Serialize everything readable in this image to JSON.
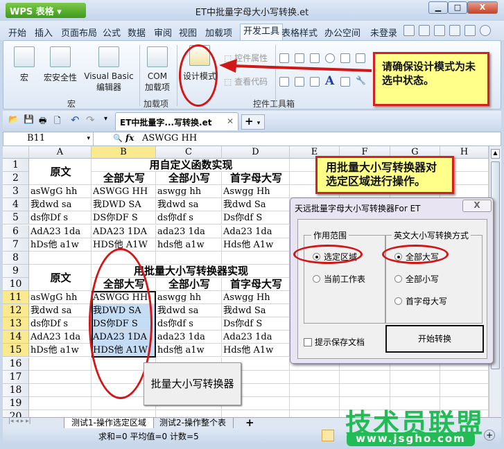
{
  "app": {
    "name": "WPS 表格",
    "title": "ET中批量字母大小写转换.et"
  },
  "menu": [
    "开始",
    "插入",
    "页面布局",
    "公式",
    "数据",
    "审阅",
    "视图",
    "加载项",
    "开发工具",
    "表格样式",
    "办公空间"
  ],
  "menu_active": "开发工具",
  "login": "未登录",
  "ribbon": {
    "macro": "宏",
    "macro_security": "宏安全性",
    "vb_editor_1": "Visual Basic",
    "vb_editor_2": "编辑器",
    "group_macro": "宏",
    "com_1": "COM",
    "com_2": "加载项",
    "group_addin": "加载项",
    "design_mode": "设计模式",
    "control_props": "控件属性",
    "view_code": "查看代码",
    "group_controls": "控件工具箱"
  },
  "callout_top": "请确保设计模式为未选中状态。",
  "callout_mid": "用批量大小写转换器对选定区域进行操作。",
  "doc_tab": "ET中批量字...写转换.et",
  "formula": {
    "cell_ref": "B11",
    "fx": "fx",
    "value": "ASWGG HH"
  },
  "columns": [
    "A",
    "B",
    "C",
    "D",
    "E",
    "F",
    "G",
    "H"
  ],
  "rows": [
    "1",
    "2",
    "3",
    "4",
    "5",
    "6",
    "7",
    "8",
    "9",
    "10",
    "11",
    "12",
    "13",
    "14",
    "15",
    "16",
    "17",
    "18",
    "19",
    "20"
  ],
  "table1": {
    "orig": "原文",
    "title": "用自定义函数实现",
    "heads": [
      "全部大写",
      "全部小写",
      "首字母大写"
    ],
    "data": [
      [
        "asWgG hh",
        "ASWGG HH",
        "aswgg hh",
        "Aswgg Hh"
      ],
      [
        "我dwd sa",
        "我DWD SA",
        "我dwd sa",
        "我dwd Sa"
      ],
      [
        "ds你Df s",
        "DS你DF S",
        "ds你df s",
        "Ds你df S"
      ],
      [
        "AdA23 1da",
        "ADA23 1DA",
        "ada23 1da",
        "Ada23 1da"
      ],
      [
        "hDs他 a1w",
        "HDS他 A1W",
        "hds他 a1w",
        "Hds他 A1w"
      ]
    ]
  },
  "table2": {
    "orig": "原文",
    "title": "用批量大小写转换器实现",
    "heads": [
      "全部大写",
      "全部小写",
      "首字母大写"
    ],
    "data": [
      [
        "asWgG hh",
        "ASWGG HH",
        "aswgg hh",
        "Aswgg Hh"
      ],
      [
        "我dwd sa",
        "我DWD SA",
        "我dwd sa",
        "我dwd Sa"
      ],
      [
        "ds你Df s",
        "DS你DF S",
        "ds你df s",
        "Ds你df S"
      ],
      [
        "AdA23 1da",
        "ADA23 1DA",
        "ada23 1da",
        "Ada23 1da"
      ],
      [
        "hDs他 a1w",
        "HDS他 A1W",
        "hds他 a1w",
        "Hds他 A1w"
      ]
    ]
  },
  "sheet_button": "批量大小写转换器",
  "dialog": {
    "title": "天远批量字母大小写转换器For ET",
    "close": "X",
    "scope_label": "作用范围",
    "scope_options": [
      "选定区域",
      "当前工作表"
    ],
    "scope_selected": 0,
    "mode_label": "英文大小写转换方式",
    "mode_options": [
      "全部大写",
      "全部小写",
      "首字母大写"
    ],
    "mode_selected": 0,
    "save_prompt": "提示保存文档",
    "save_checked": false,
    "start": "开始转换"
  },
  "sheets": [
    "测试1-操作选定区域",
    "测试2-操作整个表"
  ],
  "status": "求和=0  平均值=0  计数=5",
  "watermark": {
    "text": "技术员联盟",
    "url": "www.jsgho.com"
  }
}
